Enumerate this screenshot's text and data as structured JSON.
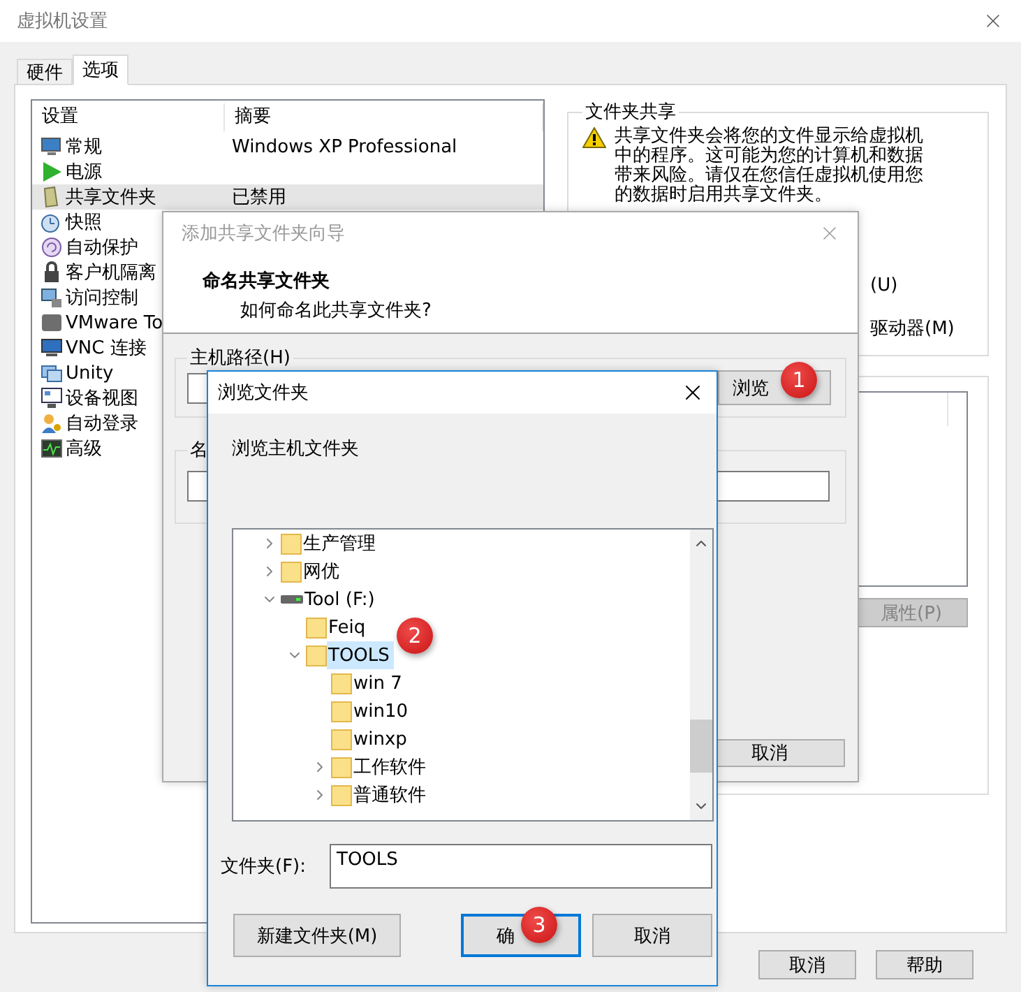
{
  "window": {
    "title": "虚拟机设置"
  },
  "tabs": [
    {
      "label": "硬件",
      "selected": false
    },
    {
      "label": "选项",
      "selected": true
    }
  ],
  "settings": {
    "columns": [
      "设置",
      "摘要"
    ],
    "rows": [
      {
        "name": "常规",
        "summary": "Windows XP Professional",
        "selected": false
      },
      {
        "name": "电源",
        "selected": false
      },
      {
        "name": "共享文件夹",
        "summary": "已禁用",
        "selected": true
      },
      {
        "name": "快照",
        "selected": false
      },
      {
        "name": "自动保护",
        "selected": false
      },
      {
        "name": "客户机隔离",
        "selected": false
      },
      {
        "name": "访问控制",
        "selected": false
      },
      {
        "name": "VMware To",
        "selected": false
      },
      {
        "name": "VNC 连接",
        "selected": false
      },
      {
        "name": "Unity",
        "selected": false
      },
      {
        "name": "设备视图",
        "selected": false
      },
      {
        "name": "自动登录",
        "selected": false
      },
      {
        "name": "高级",
        "selected": false
      }
    ]
  },
  "folder_sharing": {
    "title": "文件夹共享",
    "warning": "共享文件夹会将您的文件显示给虚拟机中的程序。这可能为您的计算机和数据带来风险。请仅在您信任虚拟机使用您的数据时启用共享文件夹。",
    "options": [
      "(U)",
      "驱动器(M)"
    ]
  },
  "folders": {
    "button": {
      "label": "属性(P)",
      "disabled": true
    }
  },
  "buttons": [
    "取消",
    "帮助"
  ],
  "wizard": {
    "title": "添加共享文件夹向导",
    "heading": "命名共享文件夹",
    "subheading": "如何命名此共享文件夹?",
    "host_path": {
      "label": "主机路径(H)",
      "browse": "浏览"
    },
    "name": {
      "label": "名"
    },
    "buttons": [
      "取消"
    ]
  },
  "browse": {
    "title": "浏览文件夹",
    "prompt": "浏览主机文件夹",
    "tree": [
      {
        "kind": "folder",
        "label": "生产管理",
        "expanded": false,
        "selected": false
      },
      {
        "kind": "folder",
        "label": "网优",
        "expanded": false,
        "selected": false
      },
      {
        "kind": "drive",
        "label": "Tool (F:)",
        "expanded": true,
        "selected": false,
        "children": [
          {
            "kind": "folder",
            "label": "Feiq",
            "selected": false
          },
          {
            "kind": "folder",
            "label": "TOOLS",
            "expanded": true,
            "selected": true,
            "children": [
              {
                "kind": "folder",
                "label": "win 7",
                "selected": false
              },
              {
                "kind": "folder",
                "label": "win10",
                "selected": false
              },
              {
                "kind": "folder",
                "label": "winxp",
                "selected": false
              },
              {
                "kind": "folder",
                "label": "工作软件",
                "expanded": false,
                "selected": false
              },
              {
                "kind": "folder",
                "label": "普通软件",
                "expanded": false,
                "selected": false
              }
            ]
          }
        ]
      }
    ],
    "folder": {
      "label": "文件夹(F):",
      "value": "TOOLS"
    },
    "buttons": [
      {
        "label": "新建文件夹(M)",
        "default": false
      },
      {
        "label": "确",
        "default": true
      },
      {
        "label": "取消",
        "default": false
      }
    ]
  },
  "callouts": [
    "1",
    "2",
    "3"
  ]
}
